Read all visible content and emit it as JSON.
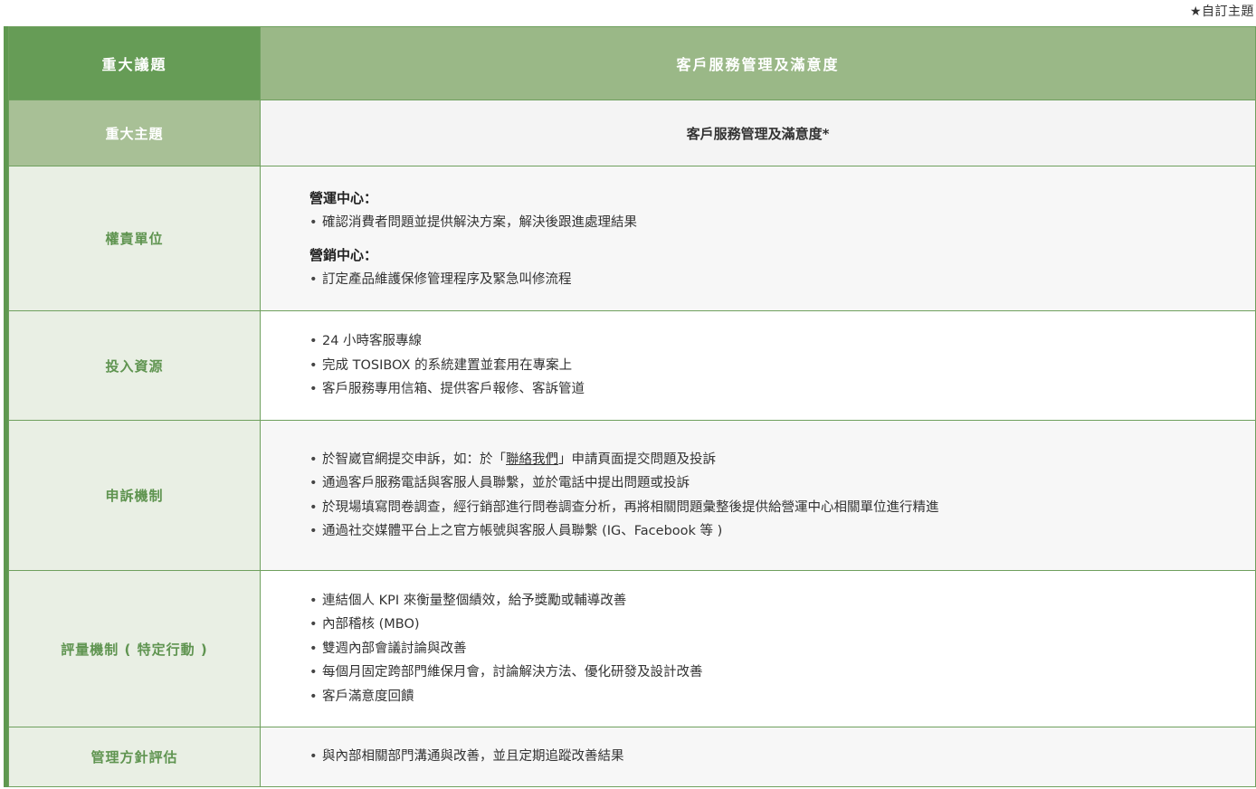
{
  "note": "★自訂主題",
  "header": {
    "label": "重大議題",
    "value": "客戶服務管理及滿意度"
  },
  "topic": {
    "label": "重大主題",
    "value": "客戶服務管理及滿意度*"
  },
  "responsibility": {
    "label": "權責單位",
    "groups": [
      {
        "title": "營運中心：",
        "items": [
          "確認消費者問題並提供解決方案，解決後跟進處理結果"
        ]
      },
      {
        "title": "營銷中心：",
        "items": [
          "訂定產品維護保修管理程序及緊急叫修流程"
        ]
      }
    ]
  },
  "resources": {
    "label": "投入資源",
    "items": [
      "24 小時客服專線",
      "完成 TOSIBOX 的系統建置並套用在專案上",
      "客戶服務專用信箱、提供客戶報修、客訴管道"
    ]
  },
  "complaint": {
    "label": "申訴機制",
    "item1_prefix": "於智崴官網提交申訴，如：於「",
    "item1_link": "聯絡我們",
    "item1_suffix": "」申請頁面提交問題及投訴",
    "items": [
      "通過客戶服務電話與客服人員聯繫，並於電話中提出問題或投訴",
      "於現場填寫問卷調查，經行銷部進行問卷調查分析，再將相關問題彙整後提供給營運中心相關單位進行精進",
      "通過社交媒體平台上之官方帳號與客服人員聯繫 (IG、Facebook 等 )"
    ]
  },
  "evaluation": {
    "label": "評量機制 ( 特定行動 )",
    "items": [
      "連結個人 KPI 來衡量整個績效，給予獎勵或輔導改善",
      "內部稽核 (MBO)",
      "雙週內部會議討論與改善",
      "每個月固定跨部門維保月會，討論解決方法、優化研發及設計改善",
      "客戶滿意度回饋"
    ]
  },
  "management": {
    "label": "管理方針評估",
    "items": [
      "與內部相關部門溝通與改善，並且定期追蹤改善結果"
    ]
  }
}
